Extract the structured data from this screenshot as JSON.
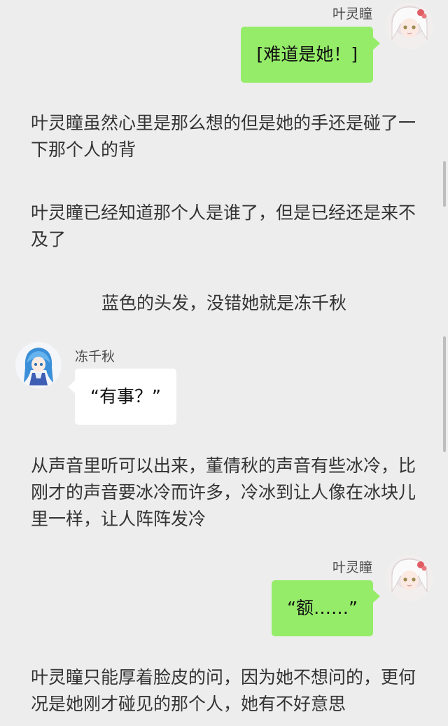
{
  "messages": [
    {
      "sender": "叶灵瞳",
      "text": "[难道是她！]"
    },
    {
      "sender": "冻千秋",
      "text": "“有事？”"
    },
    {
      "sender": "叶灵瞳",
      "text": "“额……”"
    }
  ],
  "narration": [
    "叶灵瞳虽然心里是那么想的但是她的手还是碰了一下那个人的背",
    "叶灵瞳已经知道那个人是谁了，但是已经还是来不及了",
    "蓝色的头发，没错她就是冻千秋",
    "从声音里听可以出来，董倩秋的声音有些冰冷，比刚才的声音要冰冷而许多，冷冰到让人像在冰块儿里一样，让人阵阵发冷",
    "叶灵瞳只能厚着脸皮的问，因为她不想问的，更何况是她刚才碰见的那个人，她有不好意思"
  ],
  "colors": {
    "background": "#ededed",
    "sent_bubble": "#95ec69",
    "received_bubble": "#ffffff"
  },
  "icons": {
    "avatar_sender": "white-haired-anime-girl-avatar",
    "avatar_receiver": "blue-haired-anime-girl-avatar"
  }
}
